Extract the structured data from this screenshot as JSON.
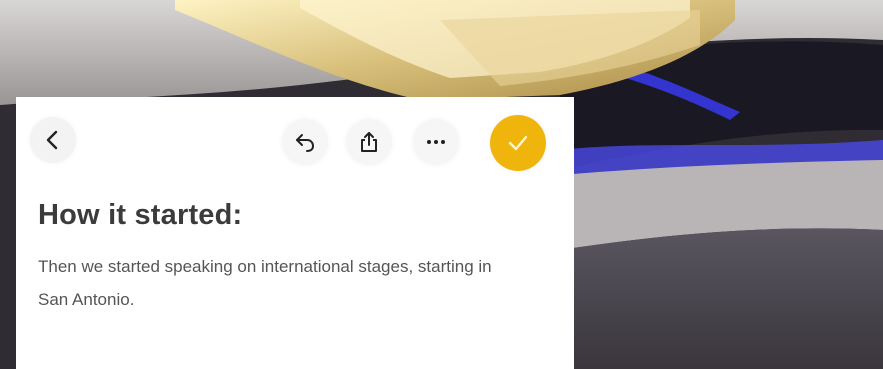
{
  "note": {
    "heading": "How it started:",
    "body": "Then we started speaking on international stages, starting in San Antonio."
  },
  "toolbar": {
    "back_icon": "chevron-left-icon",
    "undo_icon": "undo-icon",
    "share_icon": "share-icon",
    "more_icon": "ellipsis-icon",
    "done_icon": "checkmark-icon"
  },
  "colors": {
    "accent": "#f0b50d",
    "text_heading": "#3b3b3b",
    "text_body": "#555555",
    "panel_bg": "#ffffff"
  }
}
